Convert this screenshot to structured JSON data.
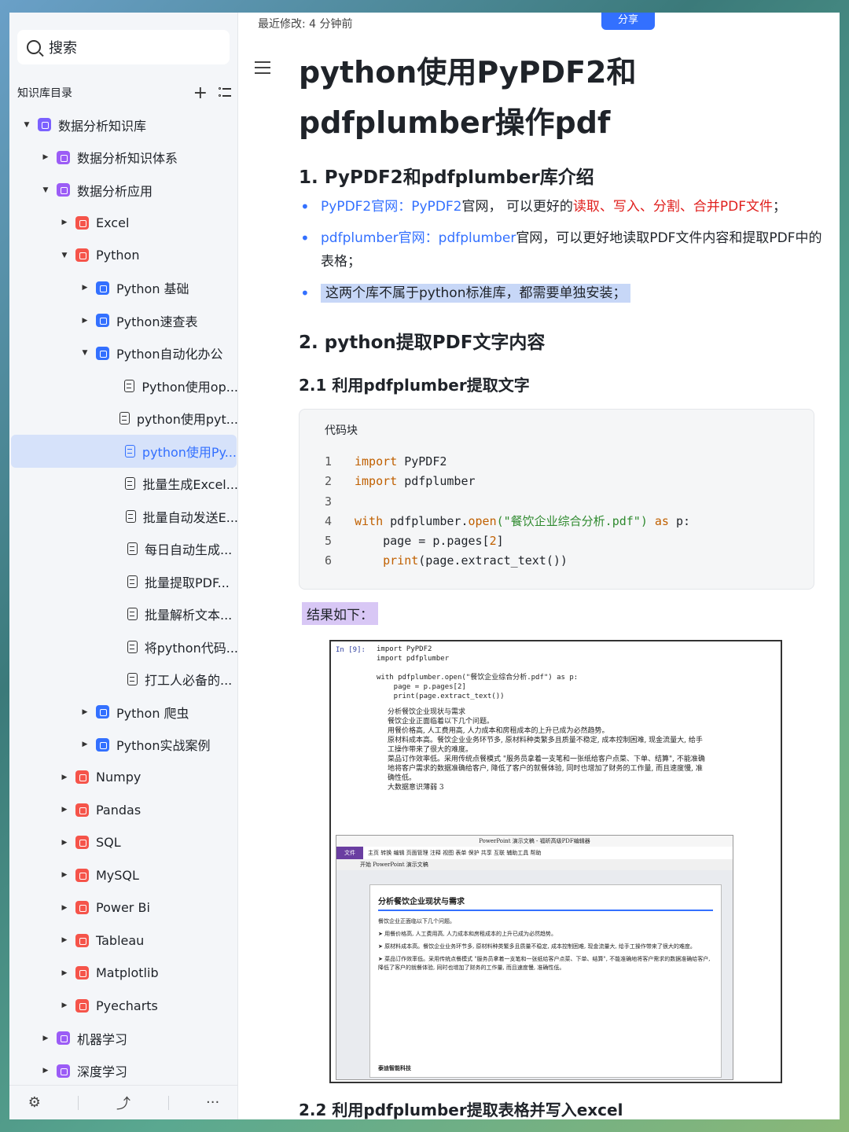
{
  "sidebar": {
    "search_label": "搜索",
    "kb_title": "知识库目录",
    "tree": [
      {
        "label": "数据分析知识库",
        "level": 0,
        "caret": "down",
        "icon": "purple"
      },
      {
        "label": "数据分析知识体系",
        "level": 1,
        "caret": "right",
        "icon": "violet"
      },
      {
        "label": "数据分析应用",
        "level": 1,
        "caret": "down",
        "icon": "violet"
      },
      {
        "label": "Excel",
        "level": 2,
        "caret": "right",
        "icon": "red"
      },
      {
        "label": "Python",
        "level": 2,
        "caret": "down",
        "icon": "red"
      },
      {
        "label": "Python 基础",
        "level": 3,
        "caret": "right",
        "icon": "blue"
      },
      {
        "label": "Python速查表",
        "level": 3,
        "caret": "right",
        "icon": "blue"
      },
      {
        "label": "Python自动化办公",
        "level": 3,
        "caret": "down",
        "icon": "blue"
      },
      {
        "label": "Python使用op...",
        "level": 4,
        "caret": "",
        "icon": "doc"
      },
      {
        "label": "python使用pyt...",
        "level": 4,
        "caret": "",
        "icon": "doc"
      },
      {
        "label": "python使用Py...",
        "level": 4,
        "caret": "",
        "icon": "doc",
        "active": true
      },
      {
        "label": "批量生成Excel...",
        "level": 4,
        "caret": "",
        "icon": "doc"
      },
      {
        "label": "批量自动发送E...",
        "level": 4,
        "caret": "",
        "icon": "doc"
      },
      {
        "label": "每日自动生成...",
        "level": 4,
        "caret": "",
        "icon": "doc"
      },
      {
        "label": "批量提取PDF...",
        "level": 4,
        "caret": "",
        "icon": "doc"
      },
      {
        "label": "批量解析文本...",
        "level": 4,
        "caret": "",
        "icon": "doc"
      },
      {
        "label": "将python代码...",
        "level": 4,
        "caret": "",
        "icon": "doc"
      },
      {
        "label": "打工人必备的...",
        "level": 4,
        "caret": "",
        "icon": "doc"
      },
      {
        "label": "Python 爬虫",
        "level": 3,
        "caret": "right",
        "icon": "blue"
      },
      {
        "label": "Python实战案例",
        "level": 3,
        "caret": "right",
        "icon": "blue"
      },
      {
        "label": "Numpy",
        "level": 2,
        "caret": "right",
        "icon": "red"
      },
      {
        "label": "Pandas",
        "level": 2,
        "caret": "right",
        "icon": "red"
      },
      {
        "label": "SQL",
        "level": 2,
        "caret": "right",
        "icon": "red"
      },
      {
        "label": "MySQL",
        "level": 2,
        "caret": "right",
        "icon": "red"
      },
      {
        "label": "Power Bi",
        "level": 2,
        "caret": "right",
        "icon": "red"
      },
      {
        "label": "Tableau",
        "level": 2,
        "caret": "right",
        "icon": "red"
      },
      {
        "label": "Matplotlib",
        "level": 2,
        "caret": "right",
        "icon": "red"
      },
      {
        "label": "Pyecharts",
        "level": 2,
        "caret": "right",
        "icon": "red"
      },
      {
        "label": "机器学习",
        "level": 1,
        "caret": "right",
        "icon": "violet"
      },
      {
        "label": "深度学习",
        "level": 1,
        "caret": "right",
        "icon": "violet"
      }
    ]
  },
  "topbar": {
    "last_modified": "最近修改: 4 分钟前",
    "share_label": "分享"
  },
  "doc": {
    "title": "python使用PyPDF2和pdfplumber操作pdf",
    "s1_heading": "1. PyPDF2和pdfplumber库介绍",
    "b1_link": "PyPDF2官网：",
    "b1_name": "PyPDF2",
    "b1_text": "官网， 可以更好的",
    "b1_red": "读取、写入、分割、合并PDF文件",
    "b1_end": "；",
    "b2_link": "pdfplumber官网：",
    "b2_name": "pdfplumber",
    "b2_text": "官网，可以更好地读取PDF文件内容和提取PDF中的表格；",
    "b3_hl": "这两个库不属于python标准库，都需要单独安装；",
    "s2_heading": "2. python提取PDF文字内容",
    "s21_heading": "2.1 利用pdfplumber提取文字",
    "code_label": "代码块",
    "result_label": "结果如下：",
    "s22_heading": "2.2 利用pdfplumber提取表格并写入excel"
  },
  "code_lines": [
    {
      "n": "1",
      "kw": "import",
      "rest": " PyPDF2"
    },
    {
      "n": "2",
      "kw": "import",
      "rest": " pdfplumber"
    },
    {
      "n": "3",
      "kw": "",
      "rest": ""
    },
    {
      "n": "4",
      "kw": "with",
      "rest": " pdfplumber.",
      "fn": "open",
      "str": "(\"餐饮企业综合分析.pdf\")",
      "kw2": " as",
      "tail": " p:"
    },
    {
      "n": "5",
      "kw": "",
      "rest": "    page = p.pages[",
      "num": "2",
      "tail": "]"
    },
    {
      "n": "6",
      "kw": "",
      "rest": "    ",
      "fn": "print",
      "tail": "(page.extract_text())"
    }
  ],
  "screenshot": {
    "prompt": "In  [9]:",
    "code": [
      "import PyPDF2",
      "import pdfplumber",
      "",
      "with pdfplumber.open(\"餐饮企业综合分析.pdf\") as p:",
      "    page = p.pages[2]",
      "    print(page.extract_text())"
    ],
    "output": [
      "分析餐饮企业现状与需求",
      "餐饮企业正面临着以下几个问题。",
      "用餐价格高, 人工费用高, 人力成本和房租成本的上升已成为必然趋势。",
      "原材料成本高。餐饮企业业务环节多, 原材料种类繁多且质量不稳定, 成本控制困难, 现金流量大, 给手",
      "工操作带来了很大的难度。",
      "菜品订作效率低。采用传统点餐模式 \"服务员拿着一支笔和一张纸给客户点菜、下单、结算\", 不能准确",
      "地将客户需求的数据准确给客户, 降低了客户的就餐体验, 同时也增加了财务的工作量, 而且速度慢, 准",
      "确性低。",
      "大数据意识薄弱 3"
    ],
    "ppt_title": "PowerPoint 演示文稿 - 福昕高级PDF编辑器",
    "ribbon_file": "文件",
    "ribbon_items": "主页  转换  编辑  页面管理  注释  视图  表单  保护  共享  互联  辅助工具  帮助",
    "tab_label": "开始      PowerPoint 演示文稿",
    "slide_title": "分析餐饮企业现状与需求",
    "slide_lines": [
      "餐饮企业正面临以下几个问题。",
      "➤ 用餐价格高, 人工费用高, 人力成本和房租成本的上升已成为必然趋势。",
      "➤ 原材料成本高。餐饮企业业务环节多, 原材料种类繁多且质量不稳定, 成本控制困难, 现金流量大, 给手工操作带来了很大的难度。",
      "➤ 菜品订作效率低。采用传统点餐模式 \"服务员拿着一支笔和一张纸给客户点菜、下单、结算\", 不能准确地将客户需求的数据准确给客户, 降低了客户的就餐体验, 同时也增加了财务的工作量, 而且速度慢, 准确性低。"
    ],
    "slide_brand": "泰迪智能科技"
  }
}
